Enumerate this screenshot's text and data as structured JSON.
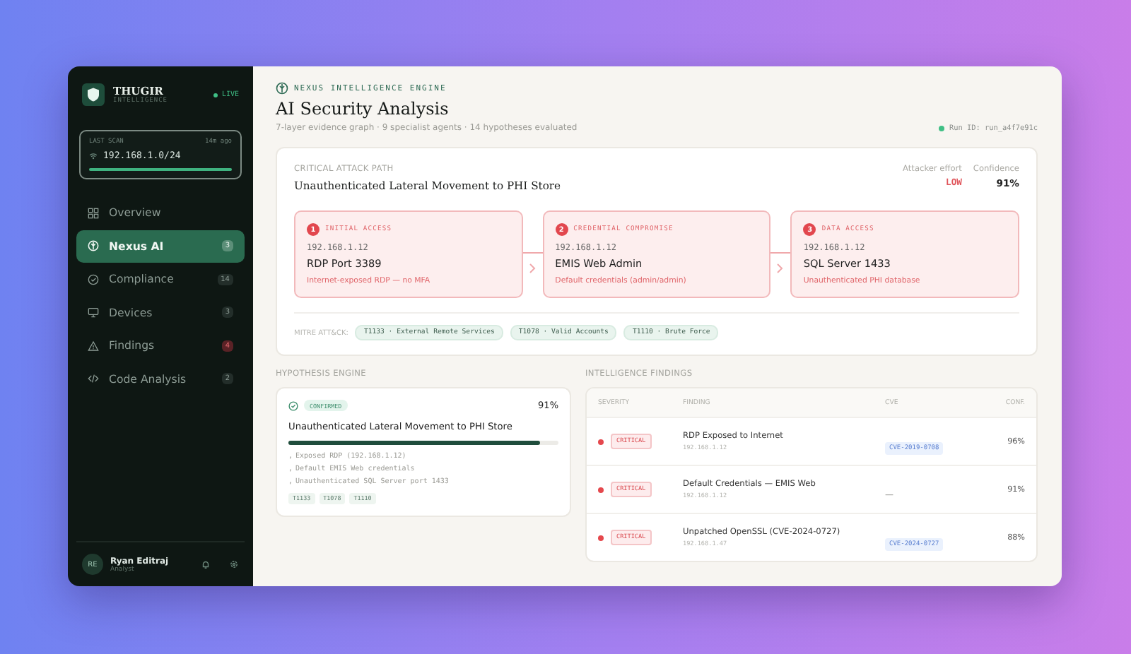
{
  "sidebar": {
    "brand": "THUGIR",
    "tagline": "INTELLIGENCE",
    "live": "LIVE",
    "scan": {
      "label": "LAST SCAN",
      "ago": "14m ago",
      "network": "192.168.1.0/24",
      "level": 1
    },
    "items": [
      {
        "label": "Overview",
        "selected": false
      },
      {
        "label": "Nexus AI",
        "count": "3",
        "selected": true,
        "alert": false
      },
      {
        "label": "Compliance",
        "count": "14",
        "selected": false,
        "alert": false
      },
      {
        "label": "Devices",
        "count": "3",
        "selected": false,
        "alert": false
      },
      {
        "label": "Findings",
        "count": "4",
        "selected": false,
        "alert": true
      },
      {
        "label": "Code Analysis",
        "count": "2",
        "selected": false,
        "alert": false
      }
    ],
    "user": {
      "initials": "RE",
      "name": "Ryan Editraj",
      "role": "Analyst"
    }
  },
  "header": {
    "eyebrow": "NEXUS INTELLIGENCE ENGINE",
    "title": "AI Security Analysis",
    "subtitle": "7-layer evidence graph · 9 specialist agents · 14 hypotheses evaluated",
    "run": "Run ID: run_a4f7e91c"
  },
  "attack_path": {
    "label": "CRITICAL ATTACK PATH",
    "title": "Unauthenticated Lateral Movement to PHI Store",
    "effort_label": "Attacker effort",
    "effort": "LOW",
    "confidence_label": "Confidence",
    "confidence": "91%",
    "steps": [
      {
        "number": "1",
        "stage": "INITIAL ACCESS",
        "ip": "192.168.1.12",
        "name": "RDP Port 3389",
        "note": "Internet-exposed RDP — no MFA"
      },
      {
        "number": "2",
        "stage": "CREDENTIAL COMPROMISE",
        "ip": "192.168.1.12",
        "name": "EMIS Web Admin",
        "note": "Default credentials (admin/admin)"
      },
      {
        "number": "3",
        "stage": "DATA ACCESS",
        "ip": "192.168.1.12",
        "name": "SQL Server 1433",
        "note": "Unauthenticated PHI database"
      }
    ],
    "mitre_label": "MITRE ATT&CK:",
    "techniques": [
      "T1133 · External Remote Services",
      "T1078 · Valid Accounts",
      "T1110 · Brute Force"
    ]
  },
  "hypotheses": {
    "heading": "HYPOTHESIS ENGINE",
    "items": [
      {
        "status": "CONFIRMED",
        "confidence": "91%",
        "title": "Unauthenticated Lateral Movement to PHI Store",
        "level": 0.93,
        "bullet": ",",
        "evidence": [
          "Exposed RDP (192.168.1.12)",
          "Default EMIS Web credentials",
          "Unauthenticated SQL Server port 1433"
        ],
        "tags": [
          "T1133",
          "T1078",
          "T1110"
        ]
      }
    ]
  },
  "findings": {
    "heading": "INTELLIGENCE FINDINGS",
    "columns": [
      "SEVERITY",
      "FINDING",
      "CVE",
      "CONF."
    ],
    "rows": [
      {
        "severity": "CRITICAL",
        "color": "#e5484d",
        "title": "RDP Exposed to Internet",
        "ip": "192.168.1.12",
        "cve": "CVE-2019-0708",
        "linked": true,
        "confidence": "96%"
      },
      {
        "severity": "CRITICAL",
        "color": "#e5484d",
        "title": "Default Credentials — EMIS Web",
        "ip": "192.168.1.12",
        "cve": "—",
        "linked": false,
        "confidence": "91%"
      },
      {
        "severity": "CRITICAL",
        "color": "#e5484d",
        "title": "Unpatched OpenSSL (CVE-2024-0727)",
        "ip": "192.168.1.47",
        "cve": "CVE-2024-0727",
        "linked": true,
        "confidence": "88%"
      }
    ]
  }
}
